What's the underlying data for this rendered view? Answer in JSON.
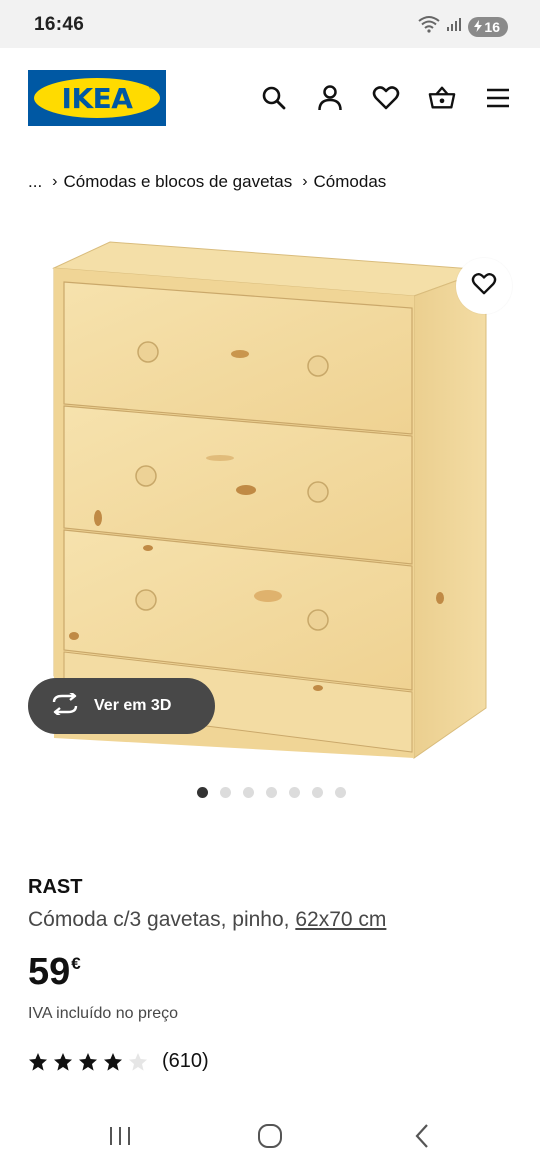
{
  "status_bar": {
    "time": "16:46",
    "battery": "16"
  },
  "header": {
    "logo_text": "IKEA",
    "icons": [
      "search-icon",
      "account-icon",
      "heart-icon",
      "basket-icon",
      "menu-icon"
    ]
  },
  "breadcrumb": {
    "ellipsis": "...",
    "items": [
      "Cómodas e blocos de gavetas",
      "Cómodas"
    ]
  },
  "gallery": {
    "view_3d_label": "Ver em 3D",
    "dot_count": 7,
    "active_dot": 1
  },
  "product": {
    "name": "RAST",
    "description": "Cómoda c/3 gavetas, pinho, ",
    "size": "62x70 cm",
    "price": "59",
    "currency": "€",
    "vat_note": "IVA incluído no preço",
    "rating_stars": 4,
    "rating_max": 5,
    "review_count": "(610)"
  },
  "colors": {
    "ikea_blue": "#0058a3",
    "ikea_yellow": "#ffdb00",
    "wood_light": "#f4dca0",
    "button_dark": "#484848"
  }
}
